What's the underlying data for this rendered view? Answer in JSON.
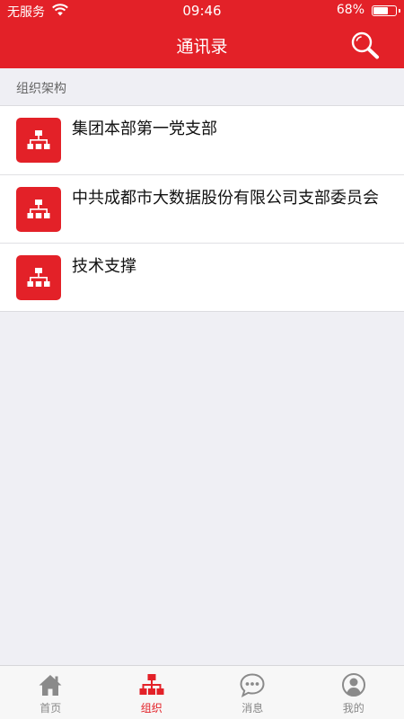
{
  "status_bar": {
    "carrier": "无服务",
    "time": "09:46",
    "battery": "68%",
    "battery_level": 0.68,
    "wifi_icon": "wifi-icon"
  },
  "nav": {
    "title": "通讯录",
    "search_icon": "search-icon"
  },
  "section": {
    "title": "组织架构"
  },
  "orgs": [
    {
      "name": "集团本部第一党支部",
      "icon": "org-chart-icon"
    },
    {
      "name": "中共成都市大数据股份有限公司支部委员会",
      "icon": "org-chart-icon"
    },
    {
      "name": "技术支撑",
      "icon": "org-chart-icon"
    }
  ],
  "tabs": [
    {
      "label": "首页",
      "icon": "home-icon",
      "active": false
    },
    {
      "label": "组织",
      "icon": "org-chart-icon",
      "active": true
    },
    {
      "label": "消息",
      "icon": "chat-bubble-icon",
      "active": false
    },
    {
      "label": "我的",
      "icon": "user-icon",
      "active": false
    }
  ],
  "colors": {
    "brand": "#e32128",
    "background": "#efeff4",
    "tab_inactive": "#888888"
  }
}
